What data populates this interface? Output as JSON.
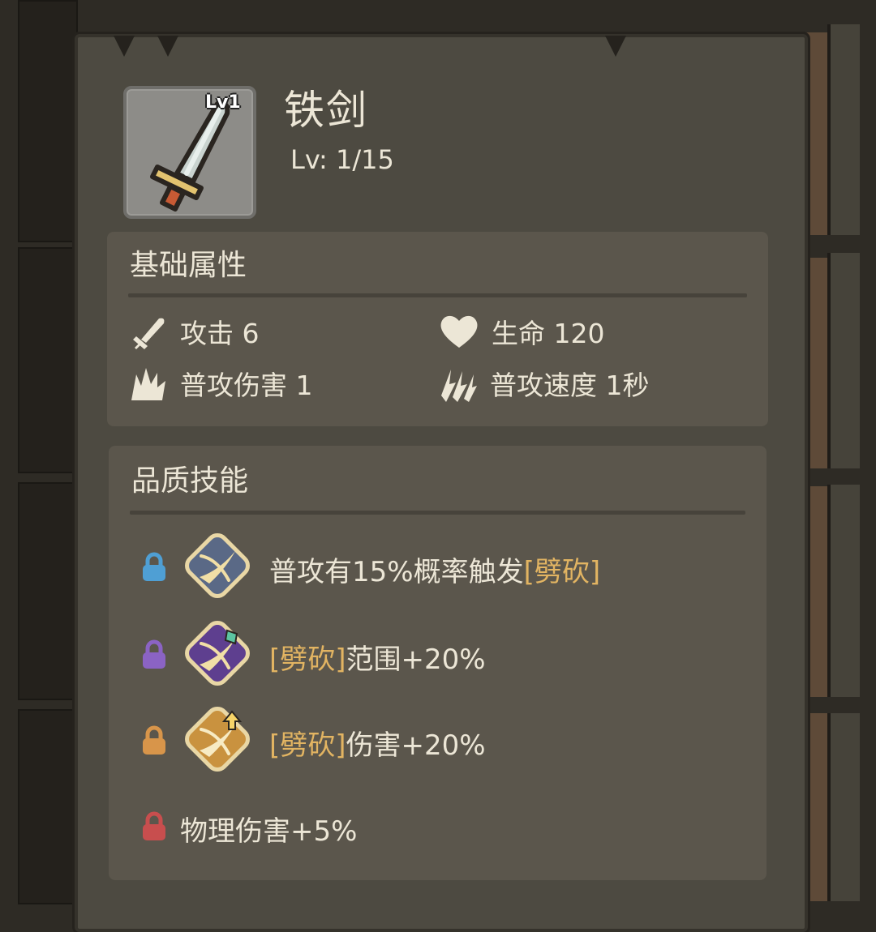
{
  "item": {
    "name": "铁剑",
    "badge": "Lv1",
    "level_text": "Lv: 1/15",
    "icon": "iron-sword-icon"
  },
  "base_section": {
    "title": "基础属性",
    "stats": [
      {
        "icon": "sword-icon",
        "label": "攻击",
        "value": "6"
      },
      {
        "icon": "heart-icon",
        "label": "生命",
        "value": "120"
      },
      {
        "icon": "claw-strike-icon",
        "label": "普攻伤害",
        "value": "1"
      },
      {
        "icon": "speed-slash-icon",
        "label": "普攻速度",
        "value": "1秒"
      }
    ]
  },
  "skill_section": {
    "title": "品质技能",
    "skills": [
      {
        "lock_color": "#4f9fd4",
        "icon": "slash-skill-icon-blue",
        "pre": "",
        "text_a": "普攻有15%概率触发",
        "highlight": "[劈砍]",
        "text_b": ""
      },
      {
        "lock_color": "#8b63c4",
        "icon": "slash-range-skill-icon-purple",
        "pre": "",
        "text_a": "",
        "highlight": "[劈砍]",
        "text_b": "范围+20%"
      },
      {
        "lock_color": "#d8954a",
        "icon": "slash-damage-skill-icon-orange",
        "pre": "",
        "text_a": "",
        "highlight": "[劈砍]",
        "text_b": "伤害+20%"
      },
      {
        "lock_color": "#c84e4e",
        "icon": "",
        "pre": "",
        "text_a": "物理伤害+5%",
        "highlight": "",
        "text_b": ""
      }
    ]
  },
  "colors": {
    "panel_bg": "#4d4a41",
    "section_bg": "#5b564c",
    "text": "#ece6d6",
    "highlight": "#e2b462"
  }
}
